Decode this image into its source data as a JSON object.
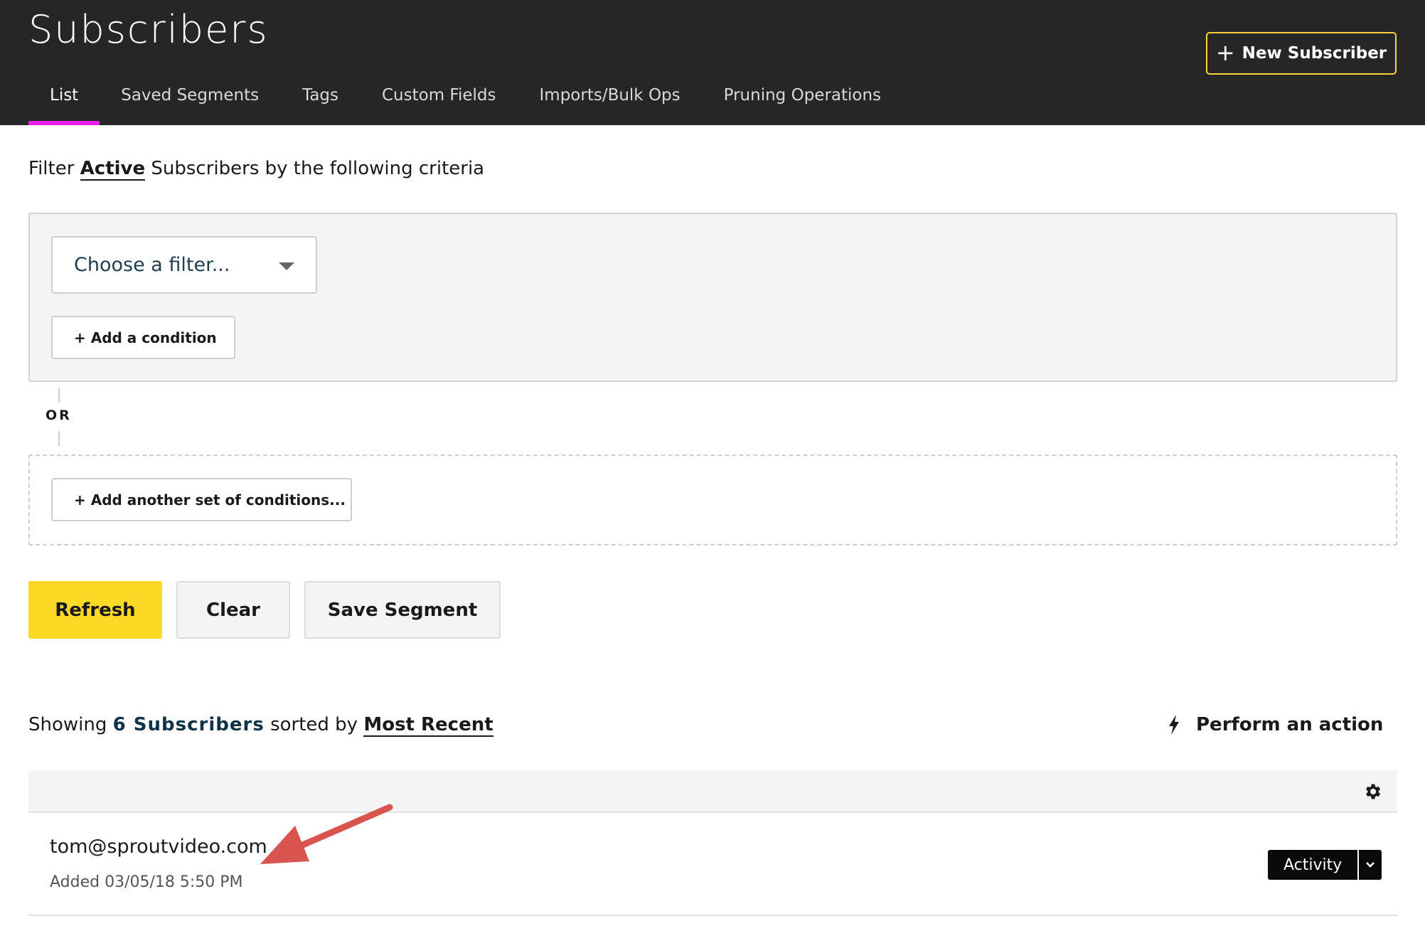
{
  "header": {
    "title": "Subscribers",
    "new_button": {
      "icon": "plus-icon",
      "label": "New Subscriber"
    },
    "accent_color": "#f5d53b",
    "active_tab_color": "#e91ee8",
    "tabs": [
      {
        "label": "List",
        "active": true
      },
      {
        "label": "Saved Segments"
      },
      {
        "label": "Tags"
      },
      {
        "label": "Custom Fields"
      },
      {
        "label": "Imports/Bulk Ops"
      },
      {
        "label": "Pruning Operations"
      }
    ]
  },
  "filter": {
    "prefix": "Filter",
    "status": "Active",
    "suffix": "Subscribers by the following criteria",
    "select_value": "Choose a filter...",
    "add_condition": "+ Add a condition",
    "or_label": "OR",
    "add_set": "+ Add another set of conditions..."
  },
  "actions": {
    "refresh": "Refresh",
    "clear": "Clear",
    "save_segment": "Save Segment",
    "refresh_color": "#fcd925"
  },
  "results": {
    "showing": "Showing",
    "count": "6 Subscribers",
    "sorted_by": "sorted by",
    "sort_value": "Most Recent",
    "perform_action": {
      "icon": "lightning-icon",
      "label": "Perform an action"
    },
    "settings_icon": "gear-icon",
    "rows": [
      {
        "email": "tom@sproutvideo.com",
        "added": "Added 03/05/18 5:50 PM",
        "action": "Activity",
        "dropdown_icon": "chevron-down-icon"
      }
    ]
  },
  "annotation": {
    "icon": "red-arrow",
    "color": "#d9534f"
  }
}
